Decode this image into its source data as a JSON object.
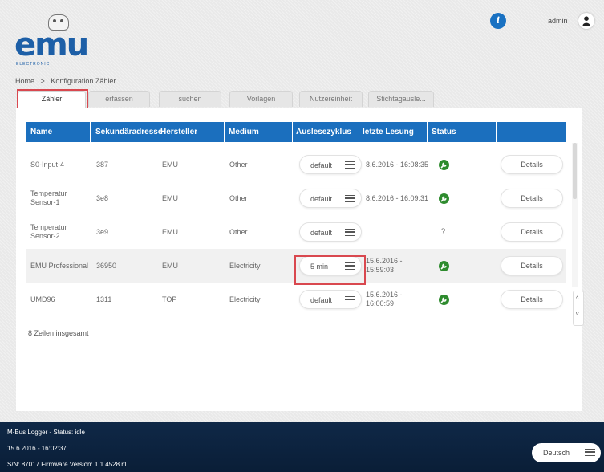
{
  "header": {
    "logo_text": "emu",
    "logo_subtext": "ELECTRONIC",
    "info_icon_glyph": "i",
    "user_name": "admin"
  },
  "breadcrumb": [
    "Home",
    ">",
    "Konfiguration Zähler"
  ],
  "tabs": [
    {
      "label": "Zähler",
      "active": true
    },
    {
      "label": "erfassen",
      "active": false
    },
    {
      "label": "suchen",
      "active": false
    },
    {
      "label": "Vorlagen",
      "active": false
    },
    {
      "label": "Nutzereinheit",
      "active": false
    },
    {
      "label": "Stichtagausle...",
      "active": false
    }
  ],
  "table": {
    "columns": [
      "Name",
      "Sekundäradresse",
      "Hersteller",
      "Medium",
      "Auslesezyklus",
      "letzte Lesung",
      "Status",
      ""
    ],
    "rows": [
      {
        "name": "S0-Input-4",
        "address": "387",
        "manufacturer": "EMU",
        "medium": "Other",
        "cycle": "default",
        "last_reading": "8.6.2016 - 16:08:35",
        "status": "ok",
        "details": "Details"
      },
      {
        "name": "Temperatur Sensor-1",
        "address": "3e8",
        "manufacturer": "EMU",
        "medium": "Other",
        "cycle": "default",
        "last_reading": "8.6.2016 - 16:09:31",
        "status": "ok",
        "details": "Details"
      },
      {
        "name": "Temperatur Sensor-2",
        "address": "3e9",
        "manufacturer": "EMU",
        "medium": "Other",
        "cycle": "default",
        "last_reading": "",
        "status": "?",
        "details": "Details"
      },
      {
        "name": "EMU Professional",
        "address": "36950",
        "manufacturer": "EMU",
        "medium": "Electricity",
        "cycle": "5 min",
        "last_reading": "15.6.2016 - 15:59:03",
        "status": "ok",
        "details": "Details"
      },
      {
        "name": "UMD96",
        "address": "1311",
        "manufacturer": "TOP",
        "medium": "Electricity",
        "cycle": "default",
        "last_reading": "15.6.2016 - 16:00:59",
        "status": "ok",
        "details": "Details"
      }
    ],
    "row_count_text": "8 Zeilen insgesamt"
  },
  "scroll_arrows": {
    "up": "^",
    "down": "v"
  },
  "footer": {
    "status_line": "M-Bus Logger - Status:   idle",
    "datetime": "15.6.2016 - 16:02:37",
    "serial_line": "S/N:  87017   Firmware Version:   1.1.4528.r1",
    "language": "Deutsch"
  },
  "colors": {
    "accent": "#1b6fbe",
    "status_ok": "#2e8b2e",
    "highlight": "#d9484f",
    "footer_bg": "#0f2847"
  }
}
